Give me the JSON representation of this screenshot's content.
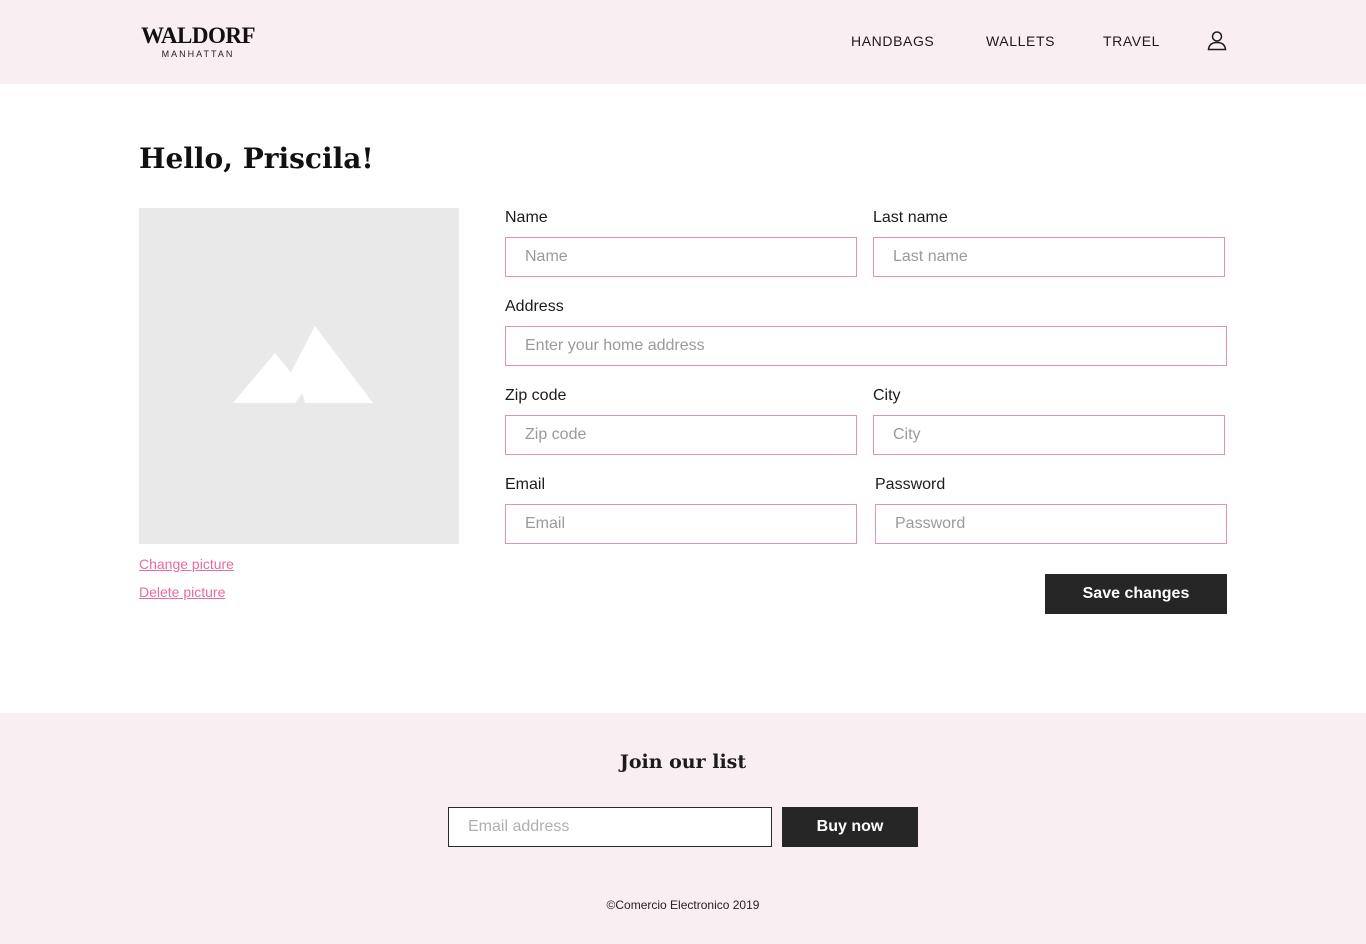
{
  "header": {
    "logo_main": "WALDORF",
    "logo_sub": "MANHATTAN",
    "nav": [
      "HANDBAGS",
      "WALLETS",
      "TRAVEL"
    ],
    "user_icon": "user-icon"
  },
  "page": {
    "title": "Hello, Priscila!"
  },
  "picture": {
    "icon": "image-placeholder-icon",
    "change_label": "Change picture",
    "delete_label": "Delete picture"
  },
  "form": {
    "name": {
      "label": "Name",
      "placeholder": "Name",
      "value": ""
    },
    "last_name": {
      "label": "Last name",
      "placeholder": "Last name",
      "value": ""
    },
    "address": {
      "label": "Address",
      "placeholder": "Enter your home address",
      "value": ""
    },
    "zip": {
      "label": "Zip code",
      "placeholder": "Zip code",
      "value": ""
    },
    "city": {
      "label": "City",
      "placeholder": "City",
      "value": ""
    },
    "email": {
      "label": "Email",
      "placeholder": "Email",
      "value": ""
    },
    "password": {
      "label": "Password",
      "placeholder": "Password",
      "value": ""
    },
    "save_label": "Save changes"
  },
  "footer": {
    "title": "Join our list",
    "email_placeholder": "Email address",
    "button_label": "Buy now",
    "copyright": "©Comercio Electronico 2019"
  },
  "colors": {
    "header_bg": "#f9eef1",
    "accent_pink": "#e86ba2",
    "field_border": "#e58dbb",
    "button_dark": "#262626"
  }
}
